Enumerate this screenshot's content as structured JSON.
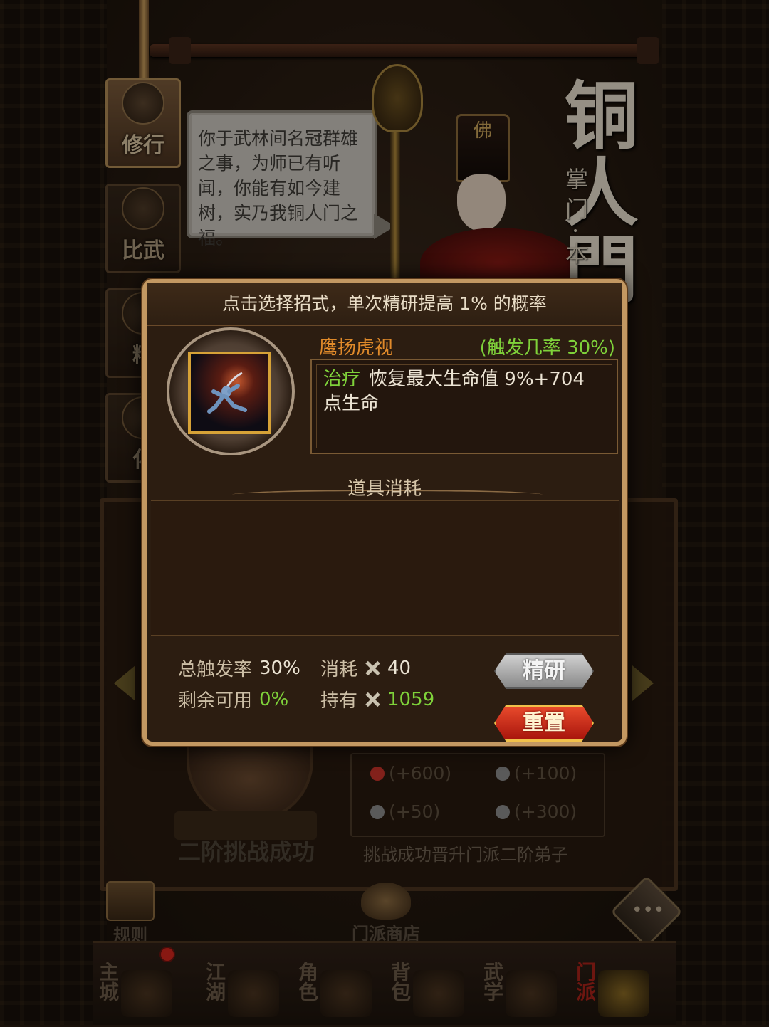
{
  "background": {
    "sect_title": "铜人門",
    "sect_subtitle": "掌门·本",
    "speech_bubble": "你于武林间名冠群雄之事，为师已有听闻，你能有如今建树，实乃我铜人门之福。",
    "hat_glyph": "佛",
    "side_tabs": [
      {
        "label": "修行",
        "active": true
      },
      {
        "label": "比武",
        "active": false
      },
      {
        "label": "精",
        "active": false
      },
      {
        "label": "化",
        "active": false
      }
    ],
    "challenge": {
      "title": "二阶挑战成功",
      "description": "挑战成功晋升门派二阶弟子",
      "rewards": [
        {
          "icon": "heart-icon",
          "text": "(+600)",
          "color": "#c8342a"
        },
        {
          "icon": "sword-icon",
          "text": "(+100)",
          "color": "#8a8a8a"
        },
        {
          "icon": "shield-icon",
          "text": "(+50)",
          "color": "#8a8a8a"
        },
        {
          "icon": "yinyang-icon",
          "text": "(+300)",
          "color": "#8a8a8a"
        }
      ]
    },
    "buttons": {
      "rules": "规则",
      "shop": "门派商店",
      "chat_glyph": "•••"
    },
    "bottom_nav": [
      {
        "label": "主城",
        "active": false
      },
      {
        "label": "江湖",
        "active": false
      },
      {
        "label": "角色",
        "active": false
      },
      {
        "label": "背包",
        "active": false
      },
      {
        "label": "武学",
        "active": false
      },
      {
        "label": "门派",
        "active": true
      }
    ]
  },
  "modal": {
    "header": "点击选择招式，单次精研提高 1% 的概率",
    "skill": {
      "name": "鹰扬虎视",
      "rate": "(触发几率 30%)",
      "effect_tag": "治疗",
      "effect_text": "恢复最大生命值 9%+704 点生命"
    },
    "cost_title": "道具消耗",
    "stats": {
      "total_rate_label": "总触发率",
      "total_rate_value": "30%",
      "remaining_label": "剩余可用",
      "remaining_value": "0%",
      "cost_label": "消耗",
      "cost_value": "40",
      "owned_label": "持有",
      "owned_value": "1059"
    },
    "buttons": {
      "refine": "精研",
      "reset": "重置"
    }
  },
  "colors": {
    "accent_gold": "#c39862",
    "green": "#7fd23a",
    "orange": "#e08a2a",
    "reset_red": "#d02a1a"
  }
}
